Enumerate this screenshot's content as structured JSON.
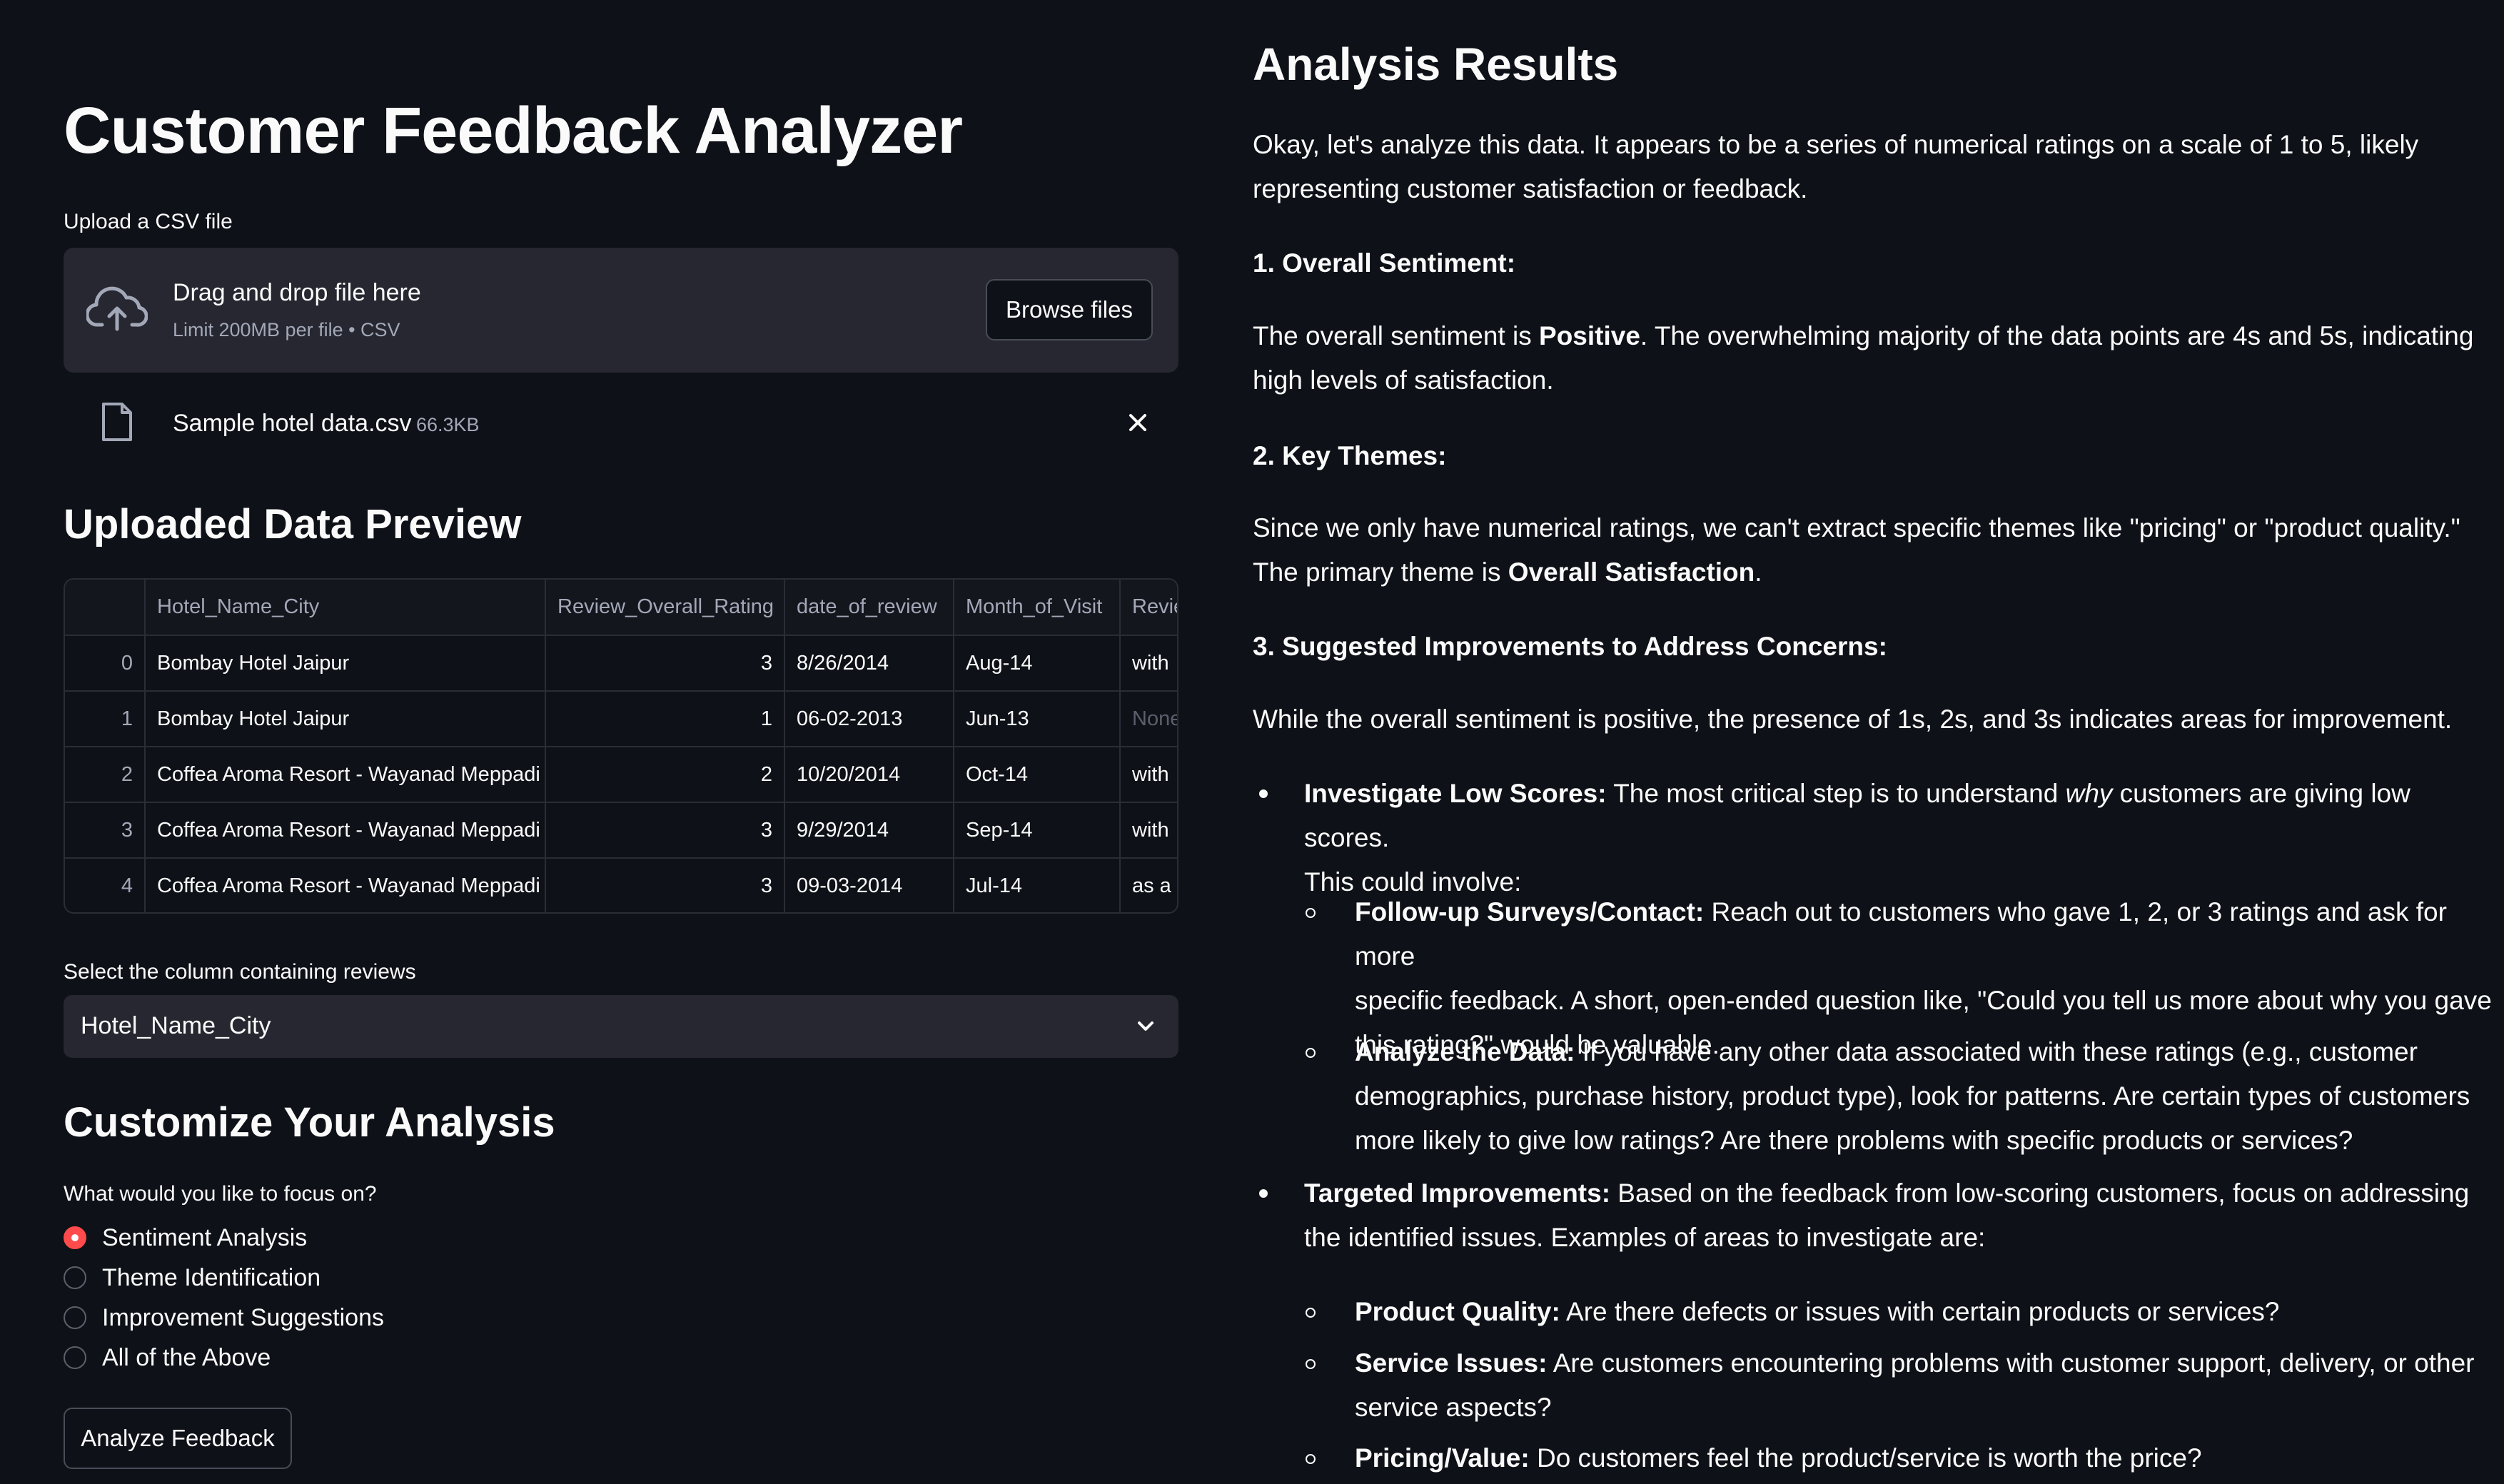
{
  "app": {
    "title": "Customer Feedback Analyzer"
  },
  "upload": {
    "label": "Upload a CSV file",
    "drop_title": "Drag and drop file here",
    "drop_limit": "Limit 200MB per file • CSV",
    "browse_label": "Browse files",
    "file_name": "Sample hotel data.csv",
    "file_size": "66.3KB"
  },
  "preview": {
    "heading": "Uploaded Data Preview",
    "columns": [
      "",
      "Hotel_Name_City",
      "Review_Overall_Rating",
      "date_of_review",
      "Month_of_Visit",
      "Revie"
    ],
    "rows": [
      [
        "0",
        "Bombay Hotel Jaipur",
        "3",
        "8/26/2014",
        "Aug-14",
        "with"
      ],
      [
        "1",
        "Bombay Hotel Jaipur",
        "1",
        "06-02-2013",
        "Jun-13",
        "None"
      ],
      [
        "2",
        "Coffea Aroma Resort - Wayanad Meppadi",
        "2",
        "10/20/2014",
        "Oct-14",
        "with"
      ],
      [
        "3",
        "Coffea Aroma Resort - Wayanad Meppadi",
        "3",
        "9/29/2014",
        "Sep-14",
        "with"
      ],
      [
        "4",
        "Coffea Aroma Resort - Wayanad Meppadi",
        "3",
        "09-03-2014",
        "Jul-14",
        "as a"
      ]
    ]
  },
  "column_select": {
    "label": "Select the column containing reviews",
    "value": "Hotel_Name_City"
  },
  "customize": {
    "heading": "Customize Your Analysis",
    "question": "What would you like to focus on?",
    "options": [
      "Sentiment Analysis",
      "Theme Identification",
      "Improvement Suggestions",
      "All of the Above"
    ],
    "selected_index": 0,
    "analyze_label": "Analyze Feedback"
  },
  "results": {
    "heading": "Analysis Results",
    "intro_1": "Okay, let's analyze this data. It appears to be a series of numerical ratings on a scale of 1 to 5, likely",
    "intro_2": "representing customer satisfaction or feedback.",
    "s1_heading": "1. Overall Sentiment:",
    "s1_a": "The overall sentiment is ",
    "s1_b": "Positive",
    "s1_c": ". The overwhelming majority of the data points are 4s and 5s, indicating",
    "s1_d": "high levels of satisfaction.",
    "s2_heading": "2. Key Themes:",
    "s2_a": "Since we only have numerical ratings, we can't extract specific themes like \"pricing\" or \"product quality.\"",
    "s2_b": "The primary theme is ",
    "s2_c": "Overall Satisfaction",
    "s2_d": ".",
    "s3_heading": "3. Suggested Improvements to Address Concerns:",
    "s3_intro": "While the overall sentiment is positive, the presence of 1s, 2s, and 3s indicates areas for improvement.",
    "b1_title": "Investigate Low Scores:",
    "b1_a": " The most critical step is to understand ",
    "b1_em": "why",
    "b1_b": " customers are giving low scores.",
    "b1_c": "This could involve:",
    "b1a_title": "Follow-up Surveys/Contact:",
    "b1a_1": " Reach out to customers who gave 1, 2, or 3 ratings and ask for more",
    "b1a_2": "specific feedback. A short, open-ended question like, \"Could you tell us more about why you gave",
    "b1a_3": "this rating?\" would be valuable.",
    "b1b_title": "Analyze the Data:",
    "b1b_1": " If you have any other data associated with these ratings (e.g., customer",
    "b1b_2": "demographics, purchase history, product type), look for patterns. Are certain types of customers",
    "b1b_3": "more likely to give low ratings? Are there problems with specific products or services?",
    "b2_title": "Targeted Improvements:",
    "b2_a": " Based on the feedback from low-scoring customers, focus on addressing",
    "b2_b": "the identified issues. Examples of areas to investigate are:",
    "b2a_title": "Product Quality:",
    "b2a_1": " Are there defects or issues with certain products or services?",
    "b2b_title": "Service Issues:",
    "b2b_1": " Are customers encountering problems with customer support, delivery, or other",
    "b2b_2": "service aspects?",
    "b2c_title": "Pricing/Value:",
    "b2c_1": " Do customers feel the product/service is worth the price?"
  },
  "colors": {
    "background": "#0e1117",
    "surface": "#262730",
    "accent": "#ff4b4b",
    "muted_text": "#a3a8b8"
  }
}
